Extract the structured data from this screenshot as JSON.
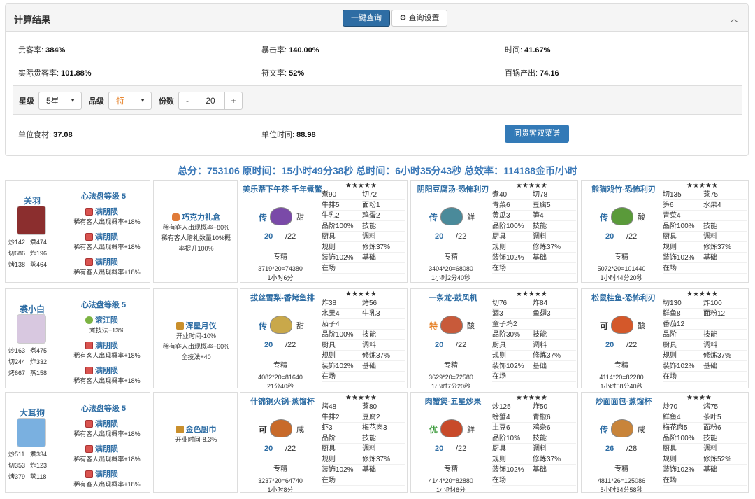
{
  "header": {
    "title": "计算结果",
    "query_label": "一键查询",
    "settings_label": "查询设置"
  },
  "stats": [
    {
      "label": "贵客率:",
      "value": "384%"
    },
    {
      "label": "暴击率:",
      "value": "140.00%"
    },
    {
      "label": "时间:",
      "value": "41.67%"
    },
    {
      "label": "实际贵客率:",
      "value": "101.88%"
    },
    {
      "label": "符文率:",
      "value": "52%"
    },
    {
      "label": "百锅产出:",
      "value": "74.16"
    }
  ],
  "controls": {
    "star_label": "星级",
    "star_value": "5星",
    "grade_label": "品级",
    "grade_value": "特",
    "portion_label": "份数",
    "portion_value": "20",
    "minus": "-",
    "plus": "+"
  },
  "unit": {
    "food_label": "单位食材:",
    "food_value": "37.08",
    "time_label": "单位时间:",
    "time_value": "88.98",
    "dual_button": "同贵客双菜谱"
  },
  "summary": "总分：753106 原时间：15小时49分38秒 总时间：6小时35分43秒 总效率：114188金币/小时",
  "rows": [
    {
      "chef": {
        "name": "关羽",
        "stats": [
          "炒142",
          "煮474",
          "切686",
          "炸196",
          "烤138",
          "蒸464"
        ],
        "avatar_color": "#8b2e2e"
      },
      "equip": {
        "title": "心法盘等级 5",
        "items": [
          {
            "name": "满朋陨",
            "desc": "稀有客人出现概率+18%",
            "icon": "red"
          },
          {
            "name": "满朋陨",
            "desc": "稀有客人出现概率+18%",
            "icon": "red"
          },
          {
            "name": "满朋陨",
            "desc": "稀有客人出现概率+18%",
            "icon": "red"
          }
        ]
      },
      "tool": {
        "name": "巧克力礼盒",
        "desc": [
          "稀有客人出现概率+80%",
          "稀有客人赠礼数量10%概",
          "率提升100%"
        ],
        "icon": "bag"
      },
      "recipes": [
        {
          "title": "美乐蒂下午茶-千年煮鳖",
          "stars": "★★★★★",
          "grade": "传",
          "grade_color": "#2e6da4",
          "flavor": "甜",
          "food_color": "#7a4aa8",
          "qty": "20",
          "total": "/22",
          "spec": "专精",
          "calc": [
            "3719*20=74380",
            "1小时6分"
          ],
          "grid": [
            [
              "煮90",
              "切72"
            ],
            [
              "牛排5",
              "面粉1"
            ],
            [
              "牛乳2",
              "鸡蛋2"
            ],
            [
              "品阶100%",
              "技能"
            ],
            [
              "厨具",
              "调料"
            ],
            [
              "规则",
              "修炼37%"
            ],
            [
              "装饰102%",
              "基础"
            ],
            [
              "在场",
              ""
            ]
          ]
        },
        {
          "title": "阴阳豆腐汤-恐怖利刃",
          "stars": "★★★★★",
          "grade": "传",
          "grade_color": "#2e6da4",
          "flavor": "鲜",
          "food_color": "#4a8a9a",
          "qty": "20",
          "total": "/22",
          "spec": "专精",
          "calc": [
            "3404*20=68080",
            "1小时2分40秒"
          ],
          "grid": [
            [
              "煮40",
              "切78"
            ],
            [
              "青菜6",
              "豆腐5"
            ],
            [
              "黄瓜3",
              "笋4"
            ],
            [
              "品阶100%",
              "技能"
            ],
            [
              "厨具",
              "调料"
            ],
            [
              "规则",
              "修炼37%"
            ],
            [
              "装饰102%",
              "基础"
            ],
            [
              "在场",
              ""
            ]
          ]
        },
        {
          "title": "熊猫戏竹-恐怖利刃",
          "stars": "★★★★★",
          "grade": "传",
          "grade_color": "#2e6da4",
          "flavor": "酸",
          "food_color": "#5a9a3a",
          "qty": "20",
          "total": "/22",
          "spec": "专精",
          "calc": [
            "5072*20=101440",
            "1小时44分20秒"
          ],
          "grid": [
            [
              "切135",
              "蒸75"
            ],
            [
              "笋6",
              "水果4"
            ],
            [
              "青菜4",
              ""
            ],
            [
              "品阶100%",
              "技能"
            ],
            [
              "厨具",
              "调料"
            ],
            [
              "规则",
              "修炼37%"
            ],
            [
              "装饰102%",
              "基础"
            ],
            [
              "在场",
              ""
            ]
          ]
        }
      ]
    },
    {
      "chef": {
        "name": "裘小白",
        "stats": [
          "炒163",
          "煮475",
          "切244",
          "炸332",
          "烤667",
          "蒸158"
        ],
        "avatar_color": "#d8c8e0"
      },
      "equip": {
        "title": "心法盘等级 5",
        "items": [
          {
            "name": "滚江陨",
            "desc": "煮技法+13%",
            "icon": "grn"
          },
          {
            "name": "满朋陨",
            "desc": "稀有客人出现概率+18%",
            "icon": "red"
          },
          {
            "name": "满朋陨",
            "desc": "稀有客人出现概率+18%",
            "icon": "red"
          }
        ]
      },
      "tool": {
        "name": "浑星月仪",
        "desc": [
          "开业时间-10%",
          "稀有客人出现概率+60%",
          "全技法+40"
        ],
        "icon": "gold"
      },
      "recipes": [
        {
          "title": "拔丝雪梨-香烤鱼排",
          "stars": "★★★★★",
          "grade": "传",
          "grade_color": "#2e6da4",
          "flavor": "甜",
          "food_color": "#c9a84a",
          "qty": "20",
          "total": "/22",
          "spec": "专精",
          "calc": [
            "4082*20=81640",
            "21分40秒"
          ],
          "grid": [
            [
              "炸38",
              "烤56"
            ],
            [
              "水果4",
              "牛乳3"
            ],
            [
              "茄子4",
              ""
            ],
            [
              "品阶100%",
              "技能"
            ],
            [
              "厨具",
              "调料"
            ],
            [
              "规则",
              "修炼37%"
            ],
            [
              "装饰102%",
              "基础"
            ],
            [
              "在场",
              ""
            ]
          ]
        },
        {
          "title": "一条龙-鼓风机",
          "stars": "★★★★★",
          "grade": "特",
          "grade_color": "#e67e22",
          "flavor": "酸",
          "food_color": "#c85a3a",
          "qty": "20",
          "total": "/22",
          "spec": "专精",
          "calc": [
            "3629*20=72580",
            "1小时7分20秒"
          ],
          "grid": [
            [
              "切76",
              "炸84"
            ],
            [
              "酒3",
              "鱼翅3"
            ],
            [
              "童子鸡2",
              ""
            ],
            [
              "品阶30%",
              "技能"
            ],
            [
              "厨具",
              "调料"
            ],
            [
              "规则",
              "修炼37%"
            ],
            [
              "装饰102%",
              "基础"
            ],
            [
              "在场",
              ""
            ]
          ]
        },
        {
          "title": "松鼠桂鱼-恐怖利刃",
          "stars": "★★★★★",
          "grade": "可",
          "grade_color": "#333",
          "flavor": "酸",
          "food_color": "#d4582a",
          "qty": "20",
          "total": "/22",
          "spec": "专精",
          "calc": [
            "4114*20=82280",
            "1小时58分40秒"
          ],
          "grid": [
            [
              "切130",
              "炸100"
            ],
            [
              "鲜鱼8",
              "面粉12"
            ],
            [
              "番茄12",
              ""
            ],
            [
              "品阶",
              "技能"
            ],
            [
              "厨具",
              "调料"
            ],
            [
              "规则",
              "修炼37%"
            ],
            [
              "装饰102%",
              "基础"
            ],
            [
              "在场",
              ""
            ]
          ]
        }
      ]
    },
    {
      "chef": {
        "name": "大耳狗",
        "stats": [
          "炒511",
          "煮334",
          "切353",
          "炸123",
          "烤379",
          "蒸118"
        ],
        "avatar_color": "#7ab0e0"
      },
      "equip": {
        "title": "心法盘等级 5",
        "items": [
          {
            "name": "满朋陨",
            "desc": "稀有客人出现概率+18%",
            "icon": "red"
          },
          {
            "name": "满朋陨",
            "desc": "稀有客人出现概率+18%",
            "icon": "red"
          },
          {
            "name": "满朋陨",
            "desc": "稀有客人出现概率+18%",
            "icon": "red"
          }
        ]
      },
      "tool": {
        "name": "金色厨巾",
        "desc": [
          "开业时间-8.3%"
        ],
        "icon": "gold"
      },
      "recipes": [
        {
          "title": "什锦铜火锅-蒸馏杯",
          "stars": "★★★★★",
          "grade": "可",
          "grade_color": "#333",
          "flavor": "咸",
          "food_color": "#c86a2a",
          "qty": "20",
          "total": "/22",
          "spec": "专精",
          "calc": [
            "3237*20=64740",
            "1小时8分"
          ],
          "grid": [
            [
              "烤48",
              "蒸80"
            ],
            [
              "牛排2",
              "豆腐2"
            ],
            [
              "虾3",
              "梅花肉3"
            ],
            [
              "品阶",
              "技能"
            ],
            [
              "厨具",
              "调料"
            ],
            [
              "规则",
              "修炼37%"
            ],
            [
              "装饰102%",
              "基础"
            ],
            [
              "在场",
              ""
            ]
          ]
        },
        {
          "title": "肉蟹煲-五星炒果",
          "stars": "★★★★★",
          "grade": "优",
          "grade_color": "#3a9a3a",
          "flavor": "鲜",
          "food_color": "#c84a2a",
          "qty": "20",
          "total": "/22",
          "spec": "专精",
          "calc": [
            "4144*20=82880",
            "1小时46分"
          ],
          "grid": [
            [
              "炒125",
              "炸50"
            ],
            [
              "螃蟹4",
              "青椒6"
            ],
            [
              "土豆6",
              "鸡杂6"
            ],
            [
              "品阶10%",
              "技能"
            ],
            [
              "厨具",
              "调料"
            ],
            [
              "规则",
              "修炼37%"
            ],
            [
              "装饰102%",
              "基础"
            ],
            [
              "在场",
              ""
            ]
          ]
        },
        {
          "title": "炒面面包-蒸馏杯",
          "stars": "★★★★",
          "grade": "传",
          "grade_color": "#2e6da4",
          "flavor": "咸",
          "food_color": "#c8843a",
          "qty": "26",
          "total": "/28",
          "spec": "专精",
          "calc": [
            "4811*26=125086",
            "5小时34分58秒"
          ],
          "grid": [
            [
              "炒70",
              "烤75"
            ],
            [
              "鲜鱼4",
              "茶叶5"
            ],
            [
              "梅花肉5",
              "面粉6"
            ],
            [
              "品阶100%",
              "技能"
            ],
            [
              "厨具",
              "调料"
            ],
            [
              "规则",
              "修炼52%"
            ],
            [
              "装饰102%",
              "基础"
            ],
            [
              "在场",
              ""
            ]
          ]
        }
      ]
    }
  ]
}
